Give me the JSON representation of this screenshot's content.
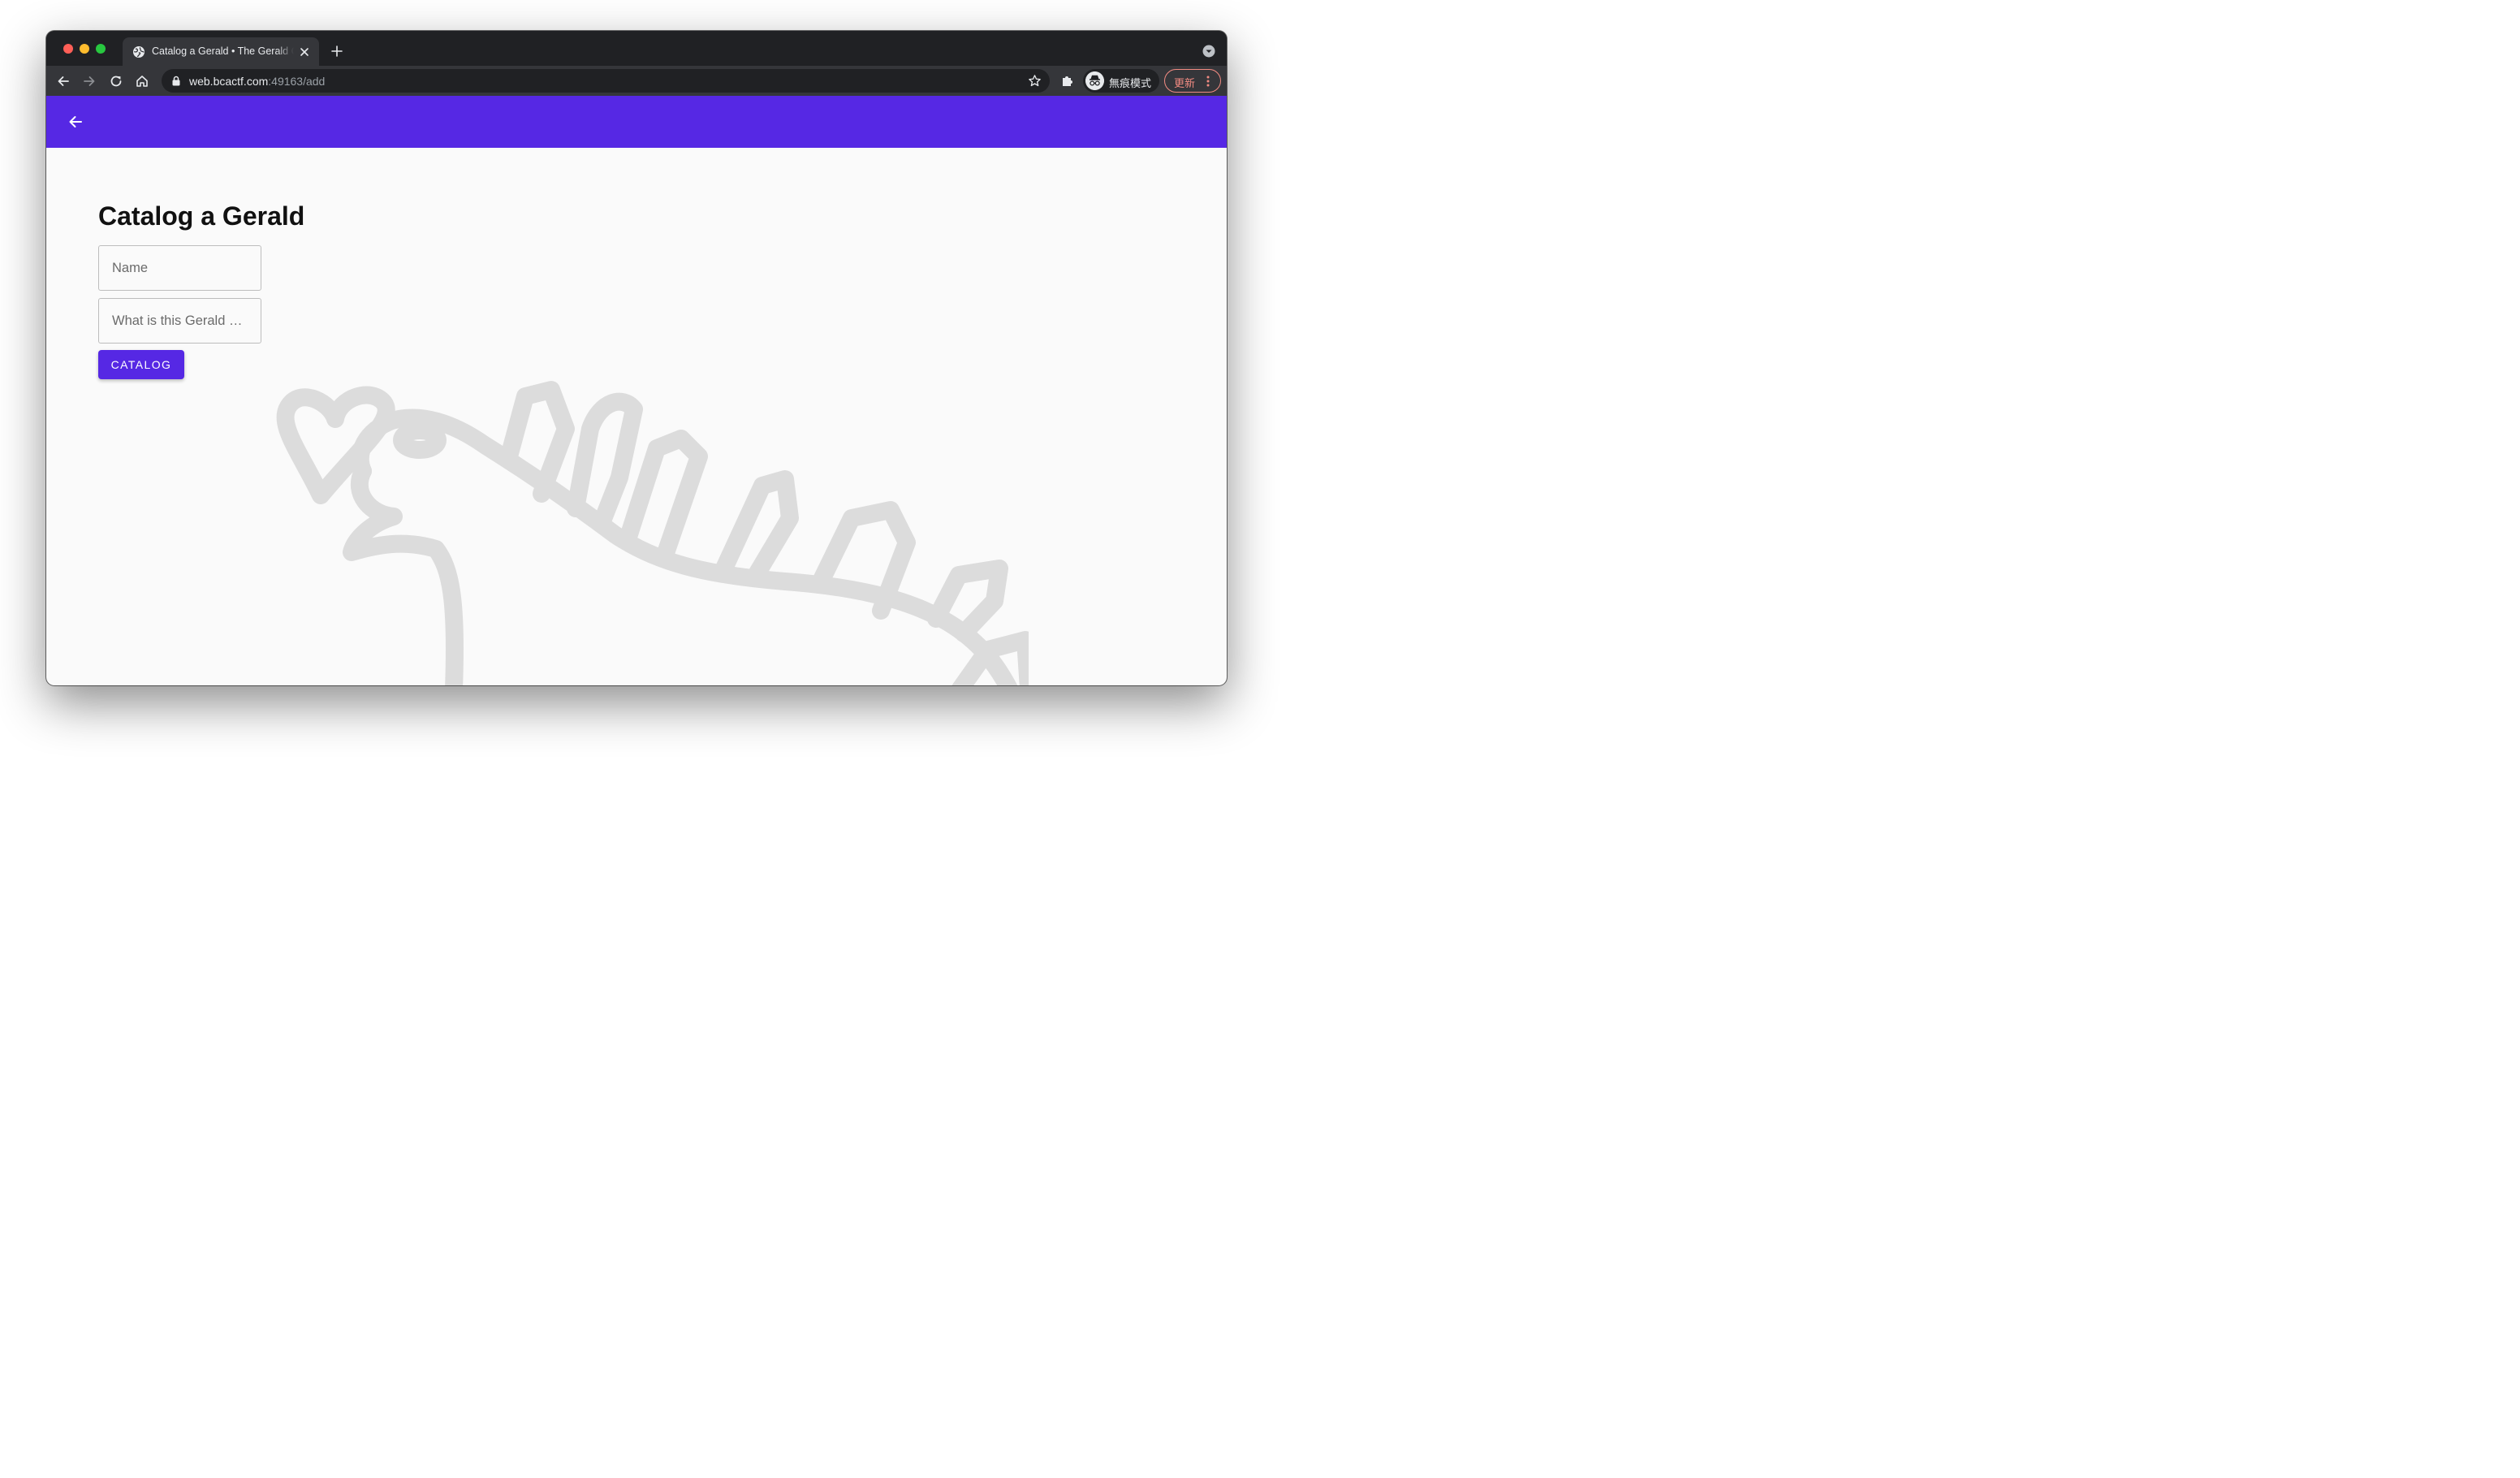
{
  "browser": {
    "tab": {
      "title": "Catalog a Gerald • The Gerald Catalog",
      "favicon": "globe-icon"
    },
    "toolbar": {
      "url_host": "web.bcactf.com",
      "url_rest": ":49163/add",
      "incognito_label": "無痕模式",
      "update_label": "更新"
    },
    "icons": {
      "close": "close-icon",
      "new_tab": "plus-icon",
      "tab_search": "chevron-down-icon",
      "back": "back-arrow-icon",
      "forward": "forward-arrow-icon",
      "reload": "reload-icon",
      "home": "home-icon",
      "lock": "lock-icon",
      "star": "star-icon",
      "extensions": "puzzle-icon",
      "menu": "kebab-menu-icon"
    }
  },
  "app": {
    "colors": {
      "primary": "#5628e4",
      "background": "#fafafa",
      "mascot_stroke": "#dcdcdc"
    },
    "header": {
      "back_icon": "arrow-left-icon"
    },
    "form": {
      "title": "Catalog a Gerald",
      "name_placeholder": "Name",
      "saying_placeholder": "What is this Gerald saying?",
      "submit_label": "Catalog"
    }
  }
}
